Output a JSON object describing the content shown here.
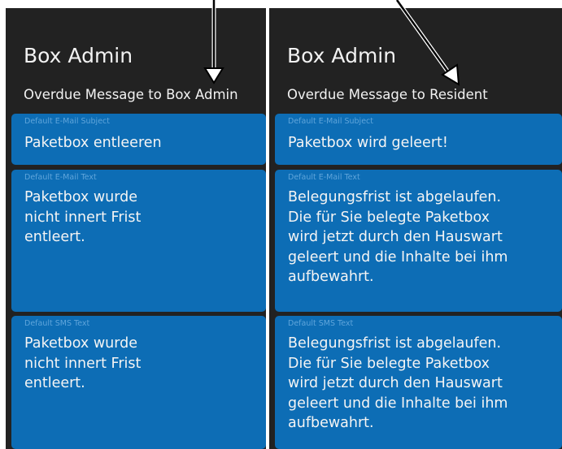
{
  "left_panel": {
    "title": "Box Admin",
    "subtitle": "Overdue Message to Box Admin",
    "subject_label": "Default E-Mail Subject",
    "subject_value": "Paketbox entleeren",
    "email_label": "Default E-Mail Text",
    "email_value": "Paketbox wurde\nnicht innert Frist\nentleert.",
    "sms_label": "Default SMS Text",
    "sms_value": "Paketbox wurde\nnicht innert Frist\nentleert."
  },
  "right_panel": {
    "title": "Box Admin",
    "subtitle": "Overdue Message to Resident",
    "subject_label": "Default E-Mail Subject",
    "subject_value": "Paketbox wird geleert!",
    "email_label": "Default E-Mail Text",
    "email_value": "Belegungsfrist ist abgelaufen.\nDie für Sie belegte Paketbox\nwird jetzt durch den Hauswart\ngeleert und die Inhalte bei ihm\naufbewahrt.",
    "sms_label": "Default SMS Text",
    "sms_value": "Belegungsfrist ist abgelaufen.\nDie für Sie belegte Paketbox\nwird jetzt durch den Hauswart\ngeleert und die Inhalte bei ihm\naufbewahrt."
  },
  "colors": {
    "panel_background": "#222222",
    "card_background": "#0d6db5",
    "label_text": "#5fa5db",
    "value_text": "#f4f4f4",
    "annotation_arrow": "#000000"
  },
  "icons": [
    "arrow-down-icon",
    "arrow-diagonal-icon"
  ]
}
